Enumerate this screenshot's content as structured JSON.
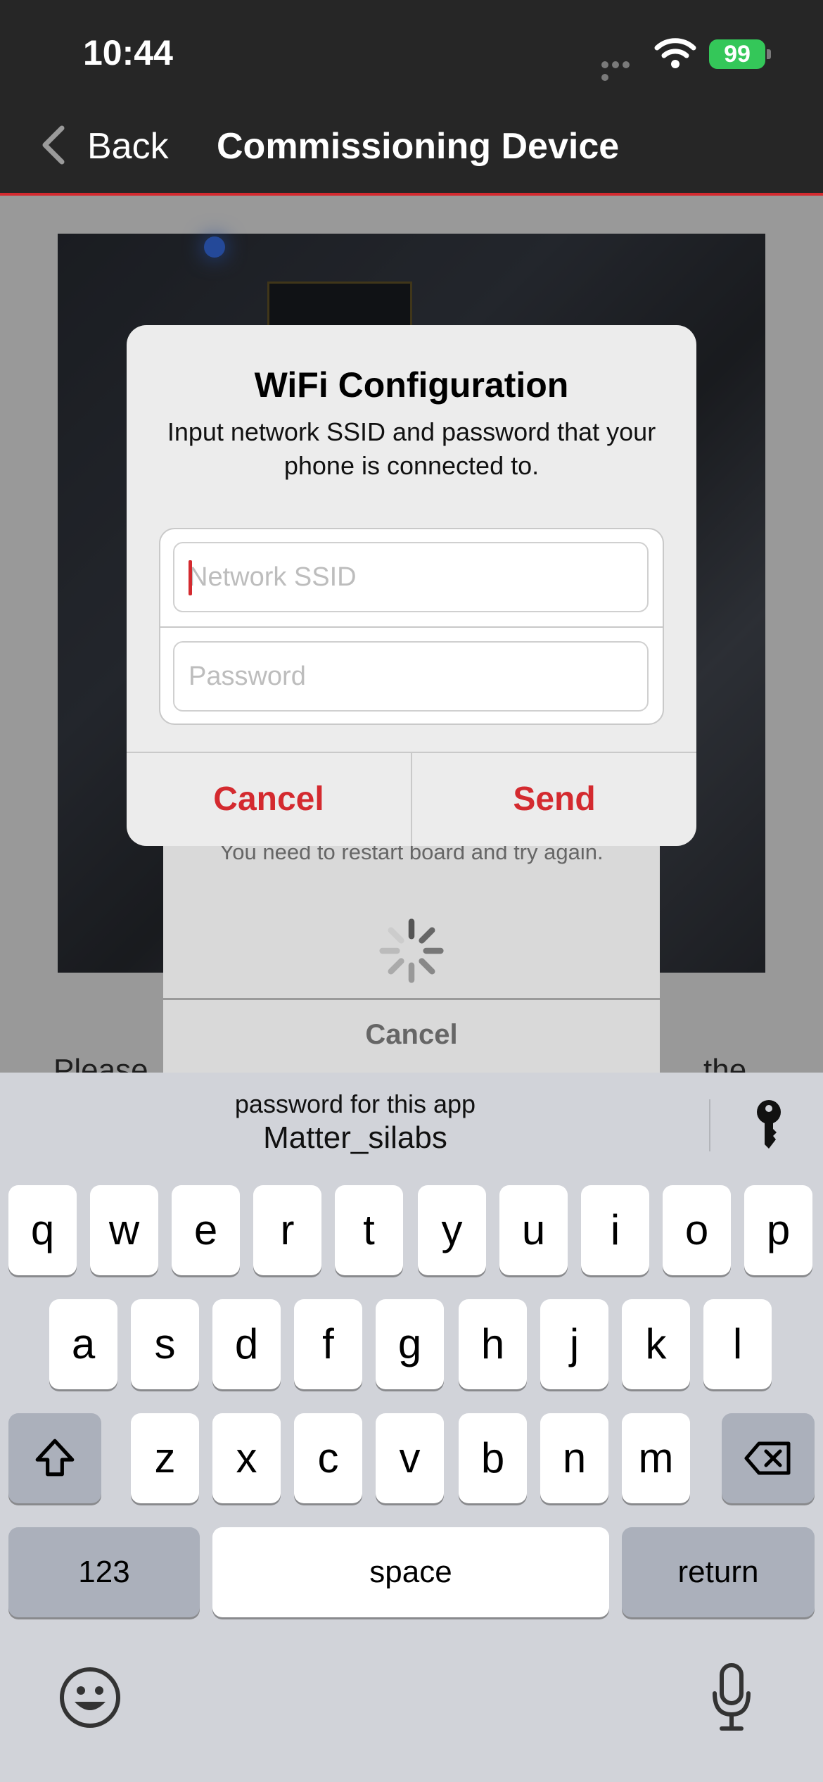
{
  "status_bar": {
    "time": "10:44",
    "battery": "99"
  },
  "nav": {
    "back_label": "Back",
    "title": "Commissioning Device"
  },
  "page": {
    "text_left": "Please",
    "text_right": "the"
  },
  "progress_alert": {
    "message": "You need to restart board and try again.",
    "cancel_label": "Cancel"
  },
  "wifi_alert": {
    "title": "WiFi Configuration",
    "message": "Input network SSID and password that your phone is connected to.",
    "ssid_placeholder": "Network SSID",
    "password_placeholder": "Password",
    "cancel_label": "Cancel",
    "send_label": "Send"
  },
  "keyboard": {
    "suggestion_label": "password for this app",
    "suggestion_value": "Matter_silabs",
    "row1": [
      "q",
      "w",
      "e",
      "r",
      "t",
      "y",
      "u",
      "i",
      "o",
      "p"
    ],
    "row2": [
      "a",
      "s",
      "d",
      "f",
      "g",
      "h",
      "j",
      "k",
      "l"
    ],
    "row3": [
      "z",
      "x",
      "c",
      "v",
      "b",
      "n",
      "m"
    ],
    "numbers_label": "123",
    "space_label": "space",
    "return_label": "return"
  },
  "colors": {
    "accent": "#d42a2f",
    "header": "#262626",
    "battery": "#34c759"
  },
  "icons": [
    "back-chevron-icon",
    "wifi-icon",
    "battery-icon",
    "key-icon",
    "shift-icon",
    "delete-icon",
    "emoji-icon",
    "microphone-icon",
    "spinner-icon"
  ]
}
